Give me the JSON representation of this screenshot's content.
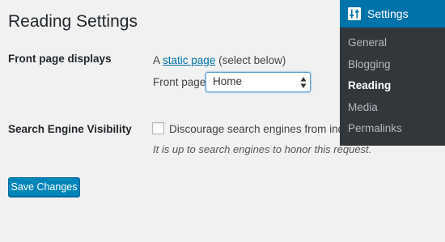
{
  "page": {
    "title": "Reading Settings"
  },
  "front_page": {
    "row_label": "Front page displays",
    "prefix": "A",
    "link_text": "static page",
    "suffix": "(select below)",
    "select_label": "Front page:",
    "select_value": "Home"
  },
  "search_visibility": {
    "row_label": "Search Engine Visibility",
    "checkbox_label": "Discourage search engines from indexing this site",
    "checked": false,
    "help_text": "It is up to search engines to honor this request."
  },
  "actions": {
    "save_label": "Save Changes"
  },
  "menu": {
    "header_label": "Settings",
    "header_icon": "settings-sliders-icon",
    "items": [
      {
        "label": "General",
        "current": false
      },
      {
        "label": "Blogging",
        "current": false
      },
      {
        "label": "Reading",
        "current": true
      },
      {
        "label": "Media",
        "current": false
      },
      {
        "label": "Permalinks",
        "current": false
      }
    ]
  },
  "colors": {
    "page_bg": "#f1f1f1",
    "menu_bg": "#32373c",
    "menu_header_bg": "#0073aa",
    "primary_button": "#0085ba",
    "link": "#0073aa"
  }
}
